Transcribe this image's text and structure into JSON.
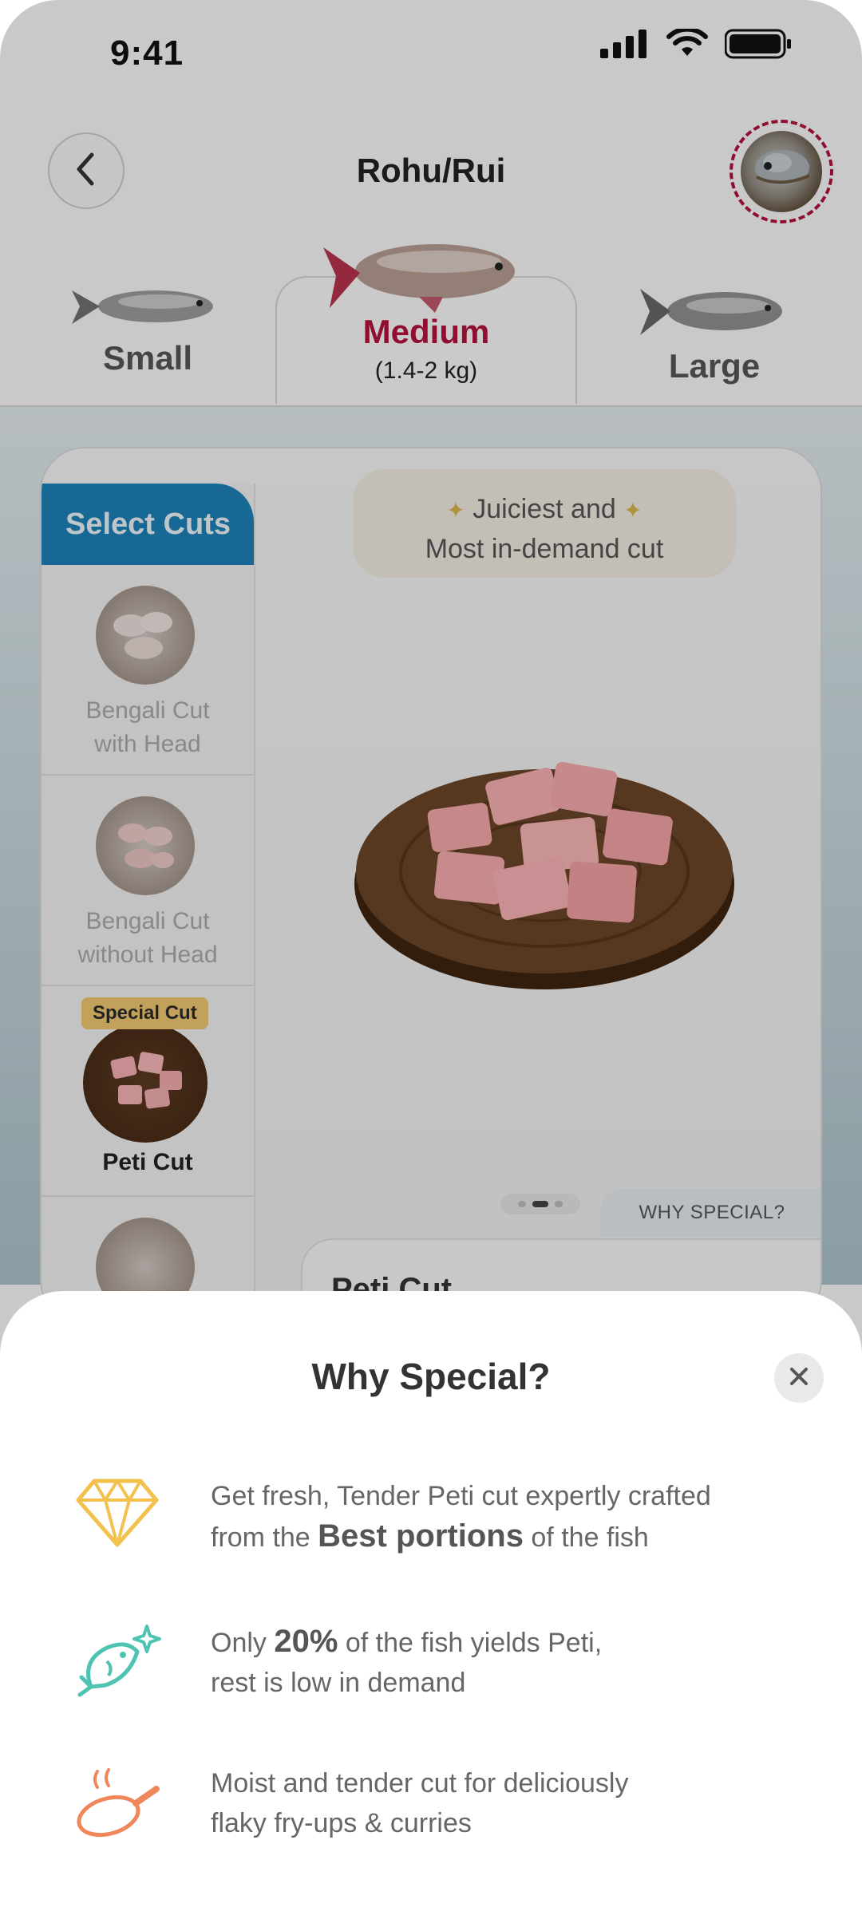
{
  "status_bar": {
    "time": "9:41"
  },
  "header": {
    "title": "Rohu/Rui"
  },
  "size_tabs": {
    "small": {
      "label": "Small"
    },
    "medium": {
      "label": "Medium",
      "weight": "(1.4-2 kg)"
    },
    "large": {
      "label": "Large"
    },
    "selected": "Medium"
  },
  "cuts": {
    "header": "Select Cuts",
    "items": [
      {
        "label_line1": "Bengali Cut",
        "label_line2": "with Head"
      },
      {
        "label_line1": "Bengali Cut",
        "label_line2": "without Head"
      },
      {
        "label": "Peti Cut",
        "badge": "Special Cut",
        "selected": true
      }
    ]
  },
  "highlight": {
    "line1": "Juiciest and",
    "line2": "Most in-demand cut"
  },
  "carousel": {
    "pages": 3,
    "active_index": 1
  },
  "why_special_tab": "WHY SPECIAL?",
  "detail_panel": {
    "title": "Peti Cut"
  },
  "sheet": {
    "title": "Why Special?",
    "features": [
      {
        "icon": "diamond-icon",
        "text_a": "Get fresh, Tender Peti cut expertly crafted",
        "text_b": "from the ",
        "emphasis": "Best portions",
        "text_c": " of the fish"
      },
      {
        "icon": "sparkle-fish-icon",
        "text_a": "Only ",
        "emphasis": "20%",
        "text_b": " of the fish yields Peti,",
        "text_c": "rest is low in demand"
      },
      {
        "icon": "frying-pan-icon",
        "text_a": "Moist and tender cut for deliciously",
        "text_b": "flaky fry-ups & curries"
      }
    ]
  },
  "colors": {
    "accent": "#b0123a",
    "cuts_header": "#1d7fb5",
    "diamond": "#f2c14e",
    "fish": "#4fc3b1",
    "pan": "#f0875a"
  }
}
